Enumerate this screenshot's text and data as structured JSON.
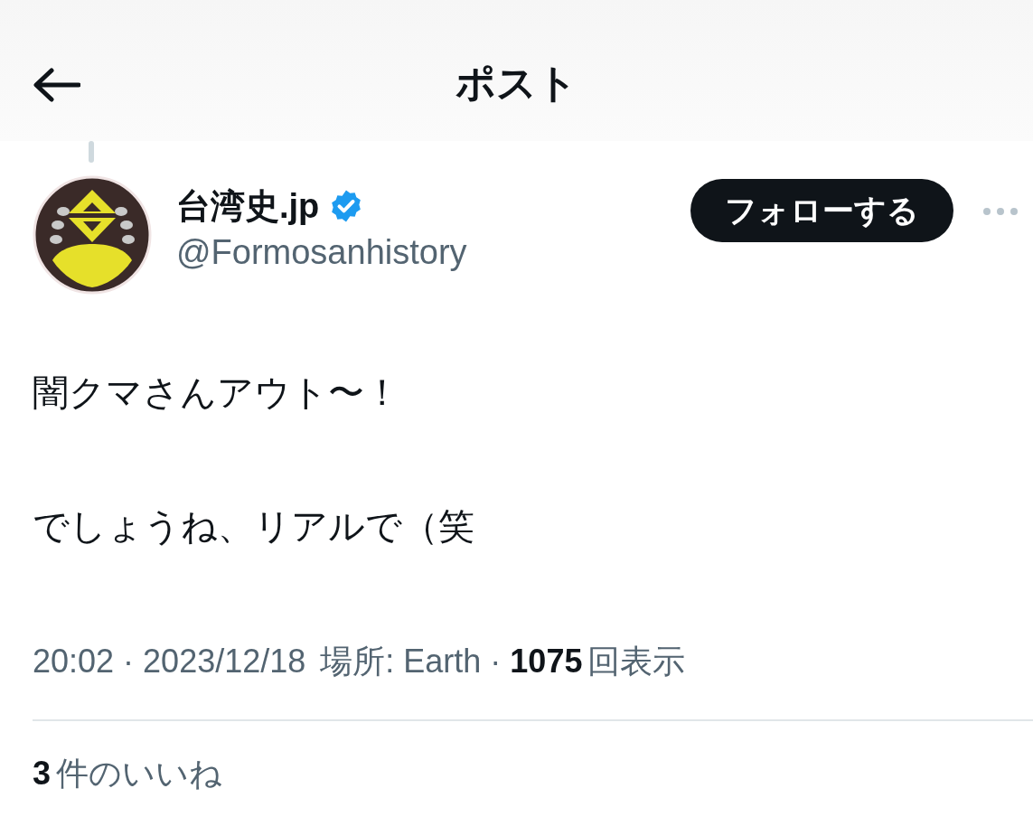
{
  "header": {
    "title": "ポスト"
  },
  "author": {
    "name": "台湾史.jp",
    "verified": true,
    "handle": "@Formosanhistory",
    "follow_label": "フォローする"
  },
  "post": {
    "lines": [
      "闇クマさんアウト〜！",
      "でしょうね、リアルで（笑"
    ]
  },
  "meta": {
    "separator": "·",
    "time": "20:02",
    "date": "2023/12/18",
    "location": "場所: Earth",
    "views_count": "1075",
    "views_label": "回表示"
  },
  "likes": {
    "count": "3",
    "label": "件のいいね"
  }
}
